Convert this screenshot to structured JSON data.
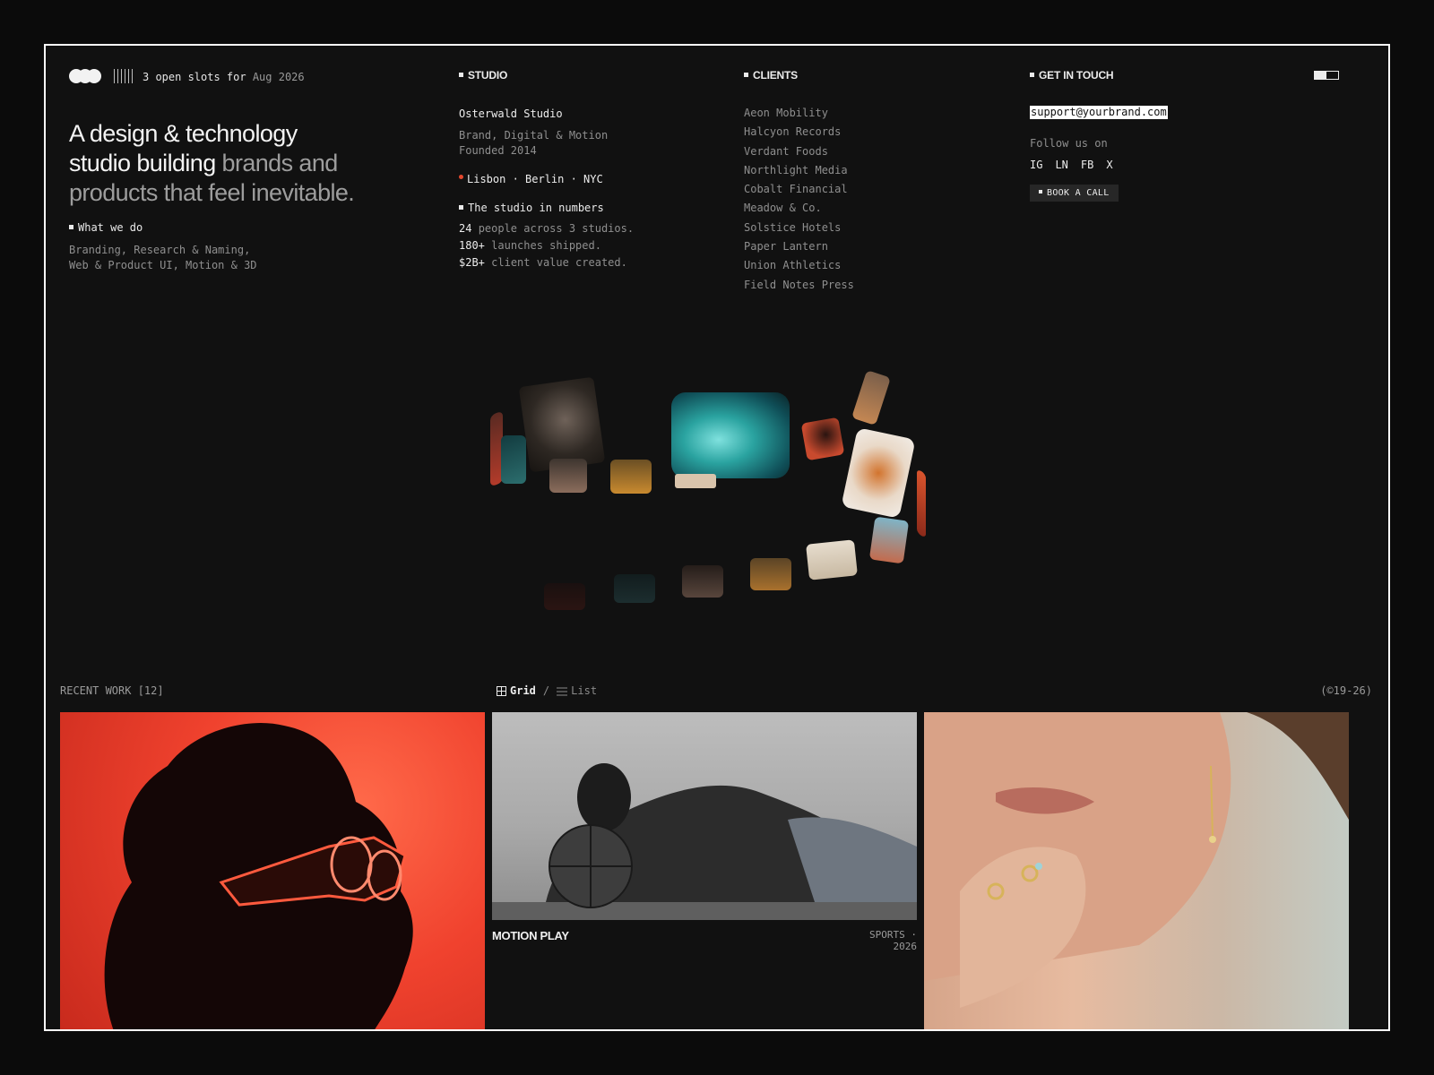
{
  "header": {
    "slots_prefix": "3 open slots for",
    "slots_date": "Aug 2026"
  },
  "hero": {
    "line1": "A design & technology",
    "line2a": "studio building",
    "line2b": "brands and",
    "line3": "products that feel inevitable."
  },
  "what_we_do": {
    "label": "What we do",
    "line1": "Branding, Research & Naming,",
    "line2": "Web & Product UI, Motion & 3D"
  },
  "studio": {
    "heading": "STUDIO",
    "name": "Osterwald Studio",
    "tagline": "Brand, Digital & Motion",
    "founded": "Founded 2014",
    "cities": "Lisbon · Berlin · NYC",
    "numbers_label": "The studio in numbers",
    "numbers": [
      {
        "value": "24",
        "text": "people across 3 studios."
      },
      {
        "value": "180+",
        "text": "launches shipped."
      },
      {
        "value": "$2B+",
        "text": "client value created."
      }
    ]
  },
  "clients": {
    "heading": "CLIENTS",
    "items": [
      "Aeon Mobility",
      "Halcyon Records",
      "Verdant Foods",
      "Northlight Media",
      "Cobalt Financial",
      "Meadow & Co.",
      "Solstice Hotels",
      "Paper Lantern",
      "Union Athletics",
      "Field Notes Press"
    ]
  },
  "contact": {
    "heading": "GET IN TOUCH",
    "email": "support@yourbrand.com",
    "follow": "Follow us on",
    "socials": [
      "IG",
      "LN",
      "FB",
      "X"
    ],
    "book_label": "BOOK A CALL"
  },
  "work": {
    "label": "RECENT WORK [12]",
    "grid_label": "Grid",
    "separator": "/",
    "list_label": "List",
    "years": "(©19-26)",
    "featured_title": "MOTION PLAY",
    "featured_meta": "SPORTS · 2026"
  },
  "colors": {
    "background": "#111111",
    "accent_red": "#e4472d",
    "text": "#eaeaea"
  }
}
